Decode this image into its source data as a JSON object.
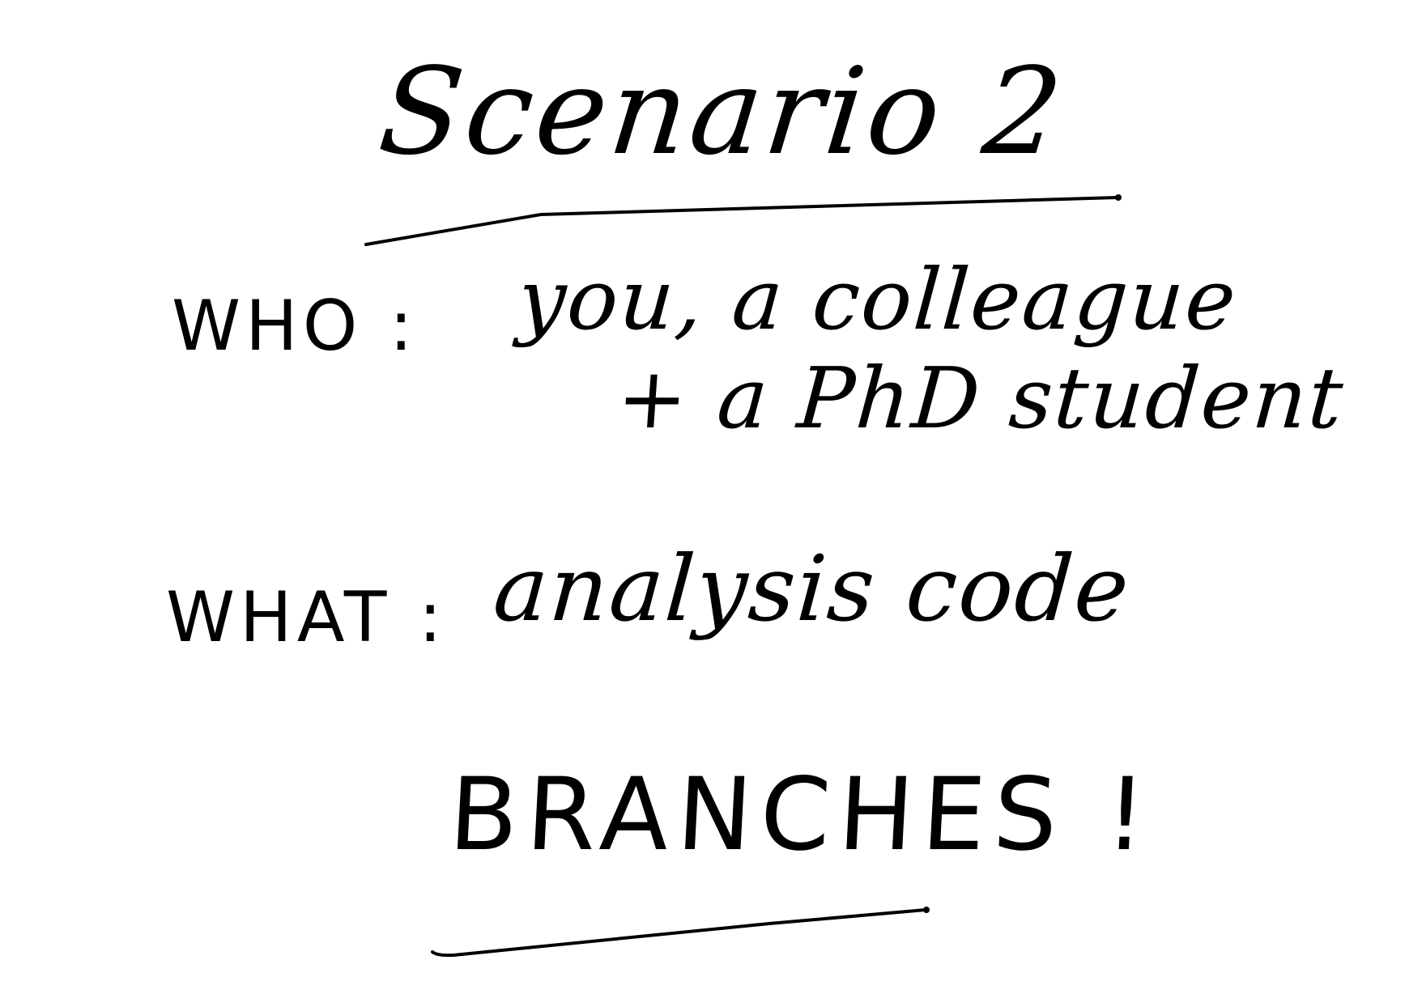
{
  "slide": {
    "title": "Scenario 2",
    "who_label": "WHO :",
    "who_value_line1": "you, a colleague",
    "who_value_line2": "+ a PhD student",
    "what_label": "WHAT :",
    "what_value": "analysis code",
    "exclamation": "BRANCHES !"
  },
  "colors": {
    "ink": "#000000",
    "paper": "#ffffff"
  }
}
